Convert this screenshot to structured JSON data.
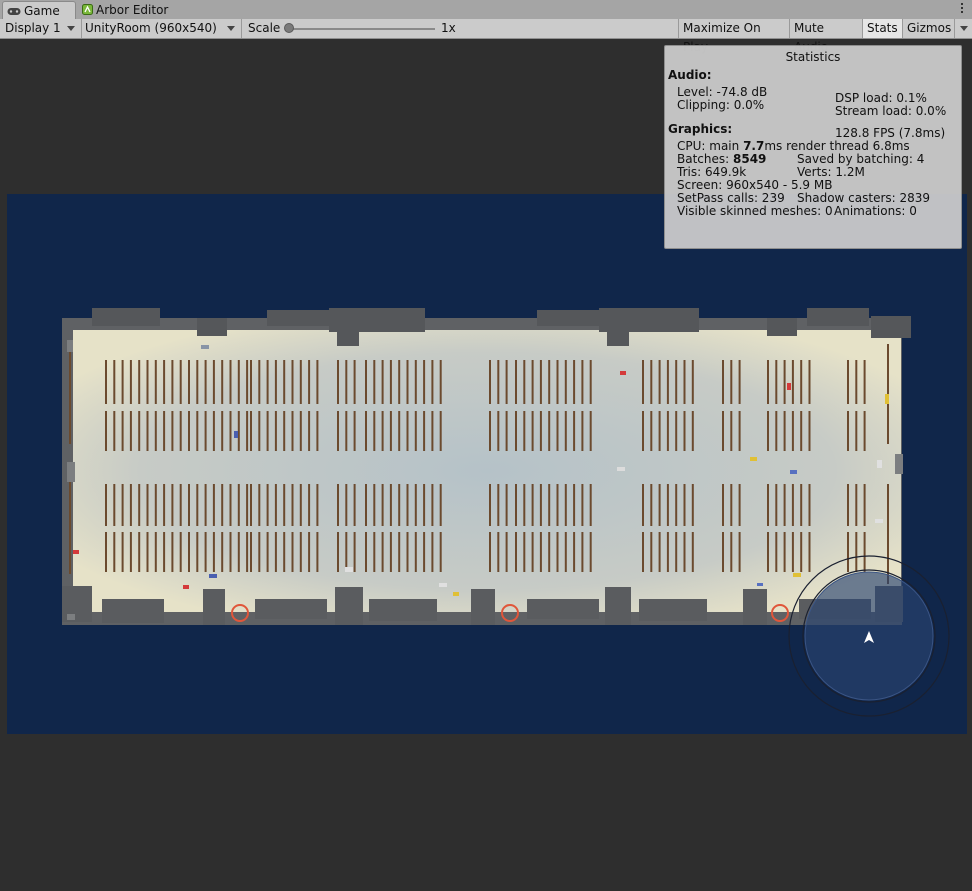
{
  "tabs": [
    {
      "label": "Game",
      "icon": "gamepad-icon"
    },
    {
      "label": "Arbor Editor",
      "icon": "arbor-icon"
    }
  ],
  "toolbar": {
    "display": "Display 1",
    "resolution": "UnityRoom (960x540)",
    "scale_label": "Scale",
    "scale_value": "1x",
    "maximize": "Maximize On Play",
    "mute": "Mute Audio",
    "stats": "Stats",
    "gizmos": "Gizmos"
  },
  "stats": {
    "title": "Statistics",
    "audio_header": "Audio:",
    "level": "Level: -74.8 dB",
    "clipping": "Clipping: 0.0%",
    "dsp": "DSP load: 0.1%",
    "stream": "Stream load: 0.0%",
    "graphics_header": "Graphics:",
    "fps": "128.8 FPS (7.8ms)",
    "cpu_prefix": "CPU: main ",
    "cpu_main": "7.7",
    "cpu_suffix": "ms  render thread 6.8ms",
    "batches_prefix": "Batches: ",
    "batches": "8549",
    "saved": "Saved by batching: 4",
    "tris": "Tris: 649.9k",
    "verts": "Verts: 1.2M",
    "screen": "Screen: 960x540 - 5.9 MB",
    "setpass": "SetPass calls: 239",
    "shadow": "Shadow casters: 2839",
    "skinned": "Visible skinned meshes: 0",
    "animations": "Animations: 0"
  },
  "colors": {
    "viewport_bg": "#10264a",
    "editor_bg": "#2e2e2e",
    "floor": "#b9bfc2",
    "shelf": "#6b4a2e",
    "marker": "#e0563a"
  }
}
